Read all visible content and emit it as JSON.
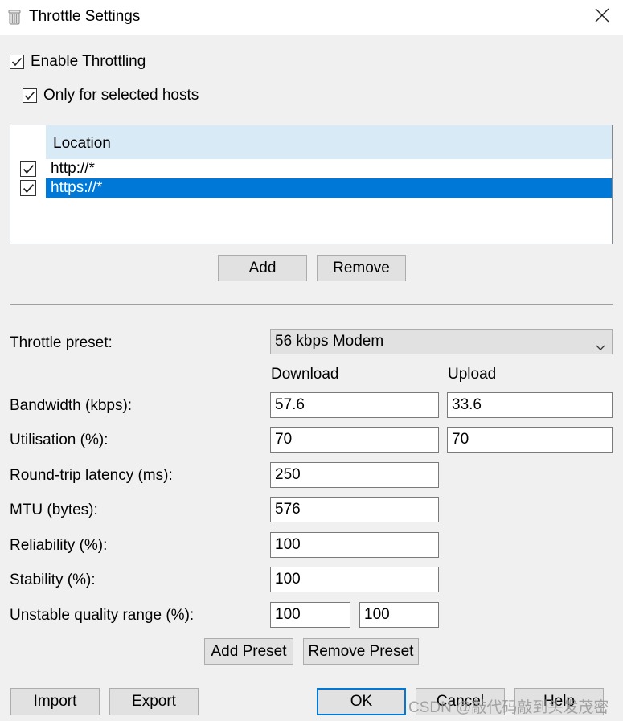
{
  "window": {
    "title": "Throttle Settings",
    "app_icon": "trash-can-icon",
    "close_icon": "close-icon"
  },
  "options": {
    "enable_throttling": "Enable Throttling",
    "only_selected_hosts": "Only for selected hosts"
  },
  "hosts": {
    "column_header": "Location",
    "rows": [
      {
        "location": "http://*",
        "checked": true,
        "selected": false
      },
      {
        "location": "https://*",
        "checked": true,
        "selected": true
      }
    ],
    "add_label": "Add",
    "remove_label": "Remove"
  },
  "preset": {
    "label": "Throttle preset:",
    "value": "56 kbps Modem",
    "chevron_icon": "chevron-down-icon"
  },
  "columns": {
    "download": "Download",
    "upload": "Upload"
  },
  "fields": {
    "bandwidth": {
      "label": "Bandwidth (kbps):",
      "download": "57.6",
      "upload": "33.6"
    },
    "utilisation": {
      "label": "Utilisation (%):",
      "download": "70",
      "upload": "70"
    },
    "latency": {
      "label": "Round-trip latency (ms):",
      "value": "250"
    },
    "mtu": {
      "label": "MTU (bytes):",
      "value": "576"
    },
    "reliability": {
      "label": "Reliability (%):",
      "value": "100"
    },
    "stability": {
      "label": "Stability (%):",
      "value": "100"
    },
    "unstable_range": {
      "label": "Unstable quality range (%):",
      "min": "100",
      "max": "100"
    }
  },
  "preset_buttons": {
    "add_preset": "Add Preset",
    "remove_preset": "Remove Preset"
  },
  "footer": {
    "import": "Import",
    "export": "Export",
    "ok": "OK",
    "cancel": "Cancel",
    "help": "Help"
  },
  "watermark": "CSDN @敲代码敲到头发茂密",
  "colors": {
    "selection": "#0078d7",
    "header_bg": "#d9eaf7",
    "window_bg": "#f0f0f0",
    "button_bg": "#e1e1e1"
  }
}
